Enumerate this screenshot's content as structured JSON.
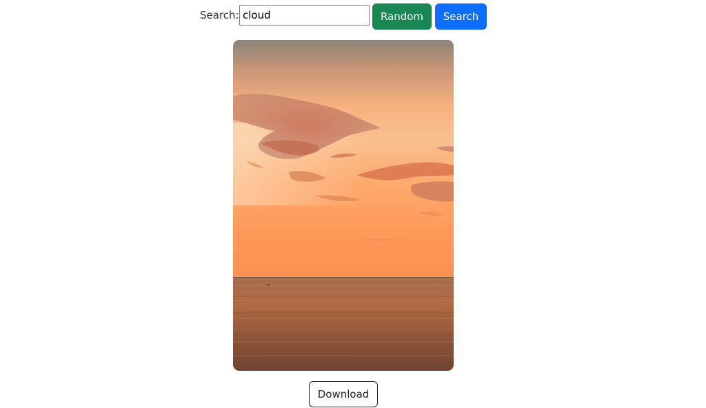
{
  "search": {
    "label": "Search:",
    "value": "cloud"
  },
  "buttons": {
    "random_label": "Random",
    "search_label": "Search",
    "download_label": "Download"
  },
  "colors": {
    "random_button": "#198754",
    "search_button": "#0d6efd"
  }
}
